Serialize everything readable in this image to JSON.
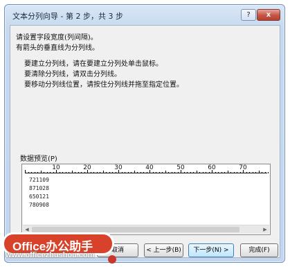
{
  "window": {
    "title": "文本分列向导 - 第 2 步，共 3 步",
    "help_label": "?",
    "close_label": "x"
  },
  "instructions": {
    "line1": "请设置字段宽度(列间隔)。",
    "line2": "有箭头的垂直线为分列线。",
    "bullets": [
      "要建立分列线，请在要建立分列处单击鼠标。",
      "要清除分列线，请双击分列线。",
      "要移动分列线位置，请按住分列线并拖至指定位置。"
    ]
  },
  "preview": {
    "label": "数据预览(P)",
    "ruler_labels": [
      "10",
      "20",
      "30",
      "40",
      "50",
      "60",
      "70"
    ],
    "rows": [
      "721109",
      "871028",
      "650121",
      "780908"
    ]
  },
  "buttons": {
    "cancel": "取消",
    "back": "< 上一步(B)",
    "next": "下一步(N) >",
    "finish": "完成(F)"
  },
  "watermark": {
    "logo": "Office办公助手",
    "url": "www.officezhushou.com"
  }
}
